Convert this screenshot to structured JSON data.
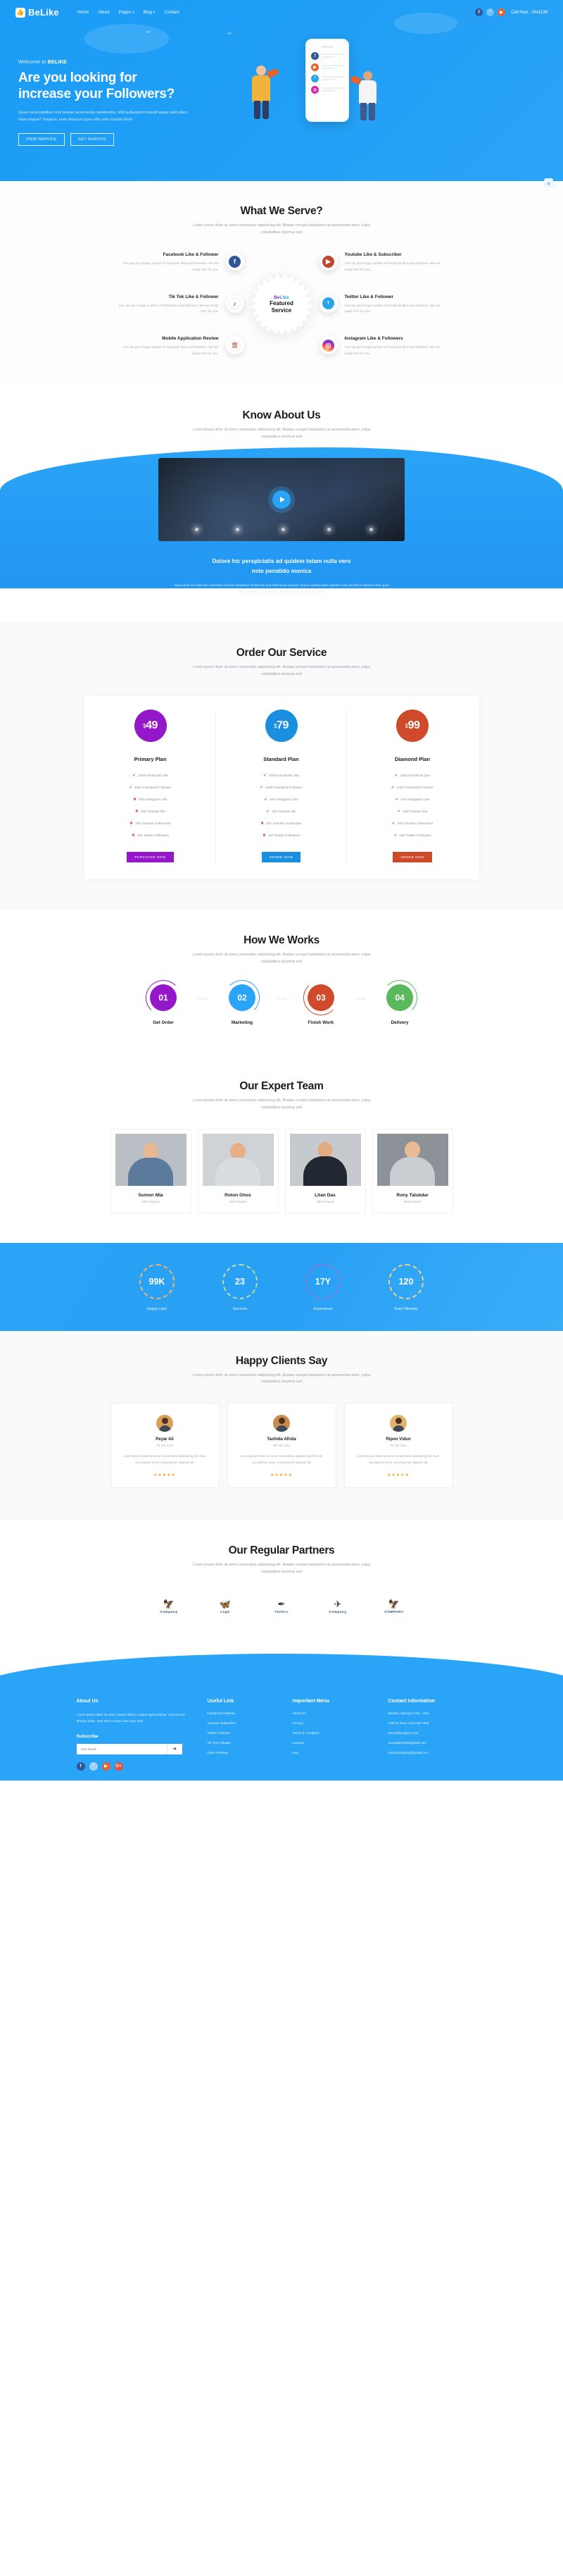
{
  "header": {
    "logo": "BeLike",
    "logo_icon": "thumbs-up-icon",
    "nav": [
      {
        "label": "Home",
        "caret": false
      },
      {
        "label": "About",
        "caret": false
      },
      {
        "label": "Pages",
        "caret": true
      },
      {
        "label": "Blog",
        "caret": true
      },
      {
        "label": "Contact",
        "caret": false
      }
    ],
    "socials": [
      {
        "name": "facebook-icon",
        "glyph": "f"
      },
      {
        "name": "twitter-icon",
        "glyph": "ᵀ"
      },
      {
        "name": "youtube-icon",
        "glyph": "▶"
      }
    ],
    "call_now": "Call Now : 2441139"
  },
  "hero": {
    "welcome_prefix": "Welcome to ",
    "welcome_brand": "BELIKE",
    "title_line1": "Are you looking for",
    "title_line2": "increase your Followers?",
    "paragraph": "Quasi necessitatibus sunt beatae assumenda repellendus, nihil quibusdam impedit eaque velit ullam, totam itaque? Tempore, iusto deserunt quas odio velit corporis illum!",
    "btn_primary": "VIEW SERVICE",
    "btn_secondary": "GET SERVICE"
  },
  "serve": {
    "title": "What We Serve?",
    "subtitle": "Lorem ipsum dolor sit amet consectetur adipisicing elit. Beatae corrupti laudantium at assumenda amet, culpa voluptatibus ducimus sed",
    "hub_brand_a": "Be",
    "hub_brand_b": "Like",
    "hub_line1": "Featured",
    "hub_line2": "Service",
    "left": [
      {
        "title": "Facebook Like & Follower",
        "text": "You can get a huge number of Facebook likes and followers. We are ready 24/7 for you.",
        "icon": "facebook-icon",
        "glyph": "f",
        "cls": "ic-fb"
      },
      {
        "title": "Tik Tok Like & Follower",
        "text": "You can get a huge number of TikTok likes and followers. We are ready 24/7 for you.",
        "icon": "tiktok-icon",
        "glyph": "♪",
        "cls": "ic-tt"
      },
      {
        "title": "Mobile Application Review",
        "text": "You can get a huge number of Facebook likes and followers. We are ready 24/7 for you.",
        "icon": "mobile-icon",
        "glyph": "☰",
        "cls": "ic-mob"
      }
    ],
    "right": [
      {
        "title": "Youtube Like & Subscriber",
        "text": "You can get a huge number of Facebook likes and followers. We are ready 24/7 for you.",
        "icon": "youtube-icon",
        "glyph": "▶",
        "cls": "ic-yt"
      },
      {
        "title": "Twitter Like & Follower",
        "text": "You can get a huge number of Facebook likes and followers. We are ready 24/7 for you.",
        "icon": "twitter-icon",
        "glyph": "ᵀ",
        "cls": "ic-tw"
      },
      {
        "title": "Instagram Like & Followers",
        "text": "You can get a huge number of Facebook likes and followers. We are ready 24/7 for you.",
        "icon": "instagram-icon",
        "glyph": "◎",
        "cls": "ic-ig"
      }
    ]
  },
  "about": {
    "title": "Know About Us",
    "subtitle": "Lorem ipsum dolor sit amet consectetur adipisicing elit. Beatae corrupti laudantium at assumenda amet, culpa voluptatibus ducimus sed",
    "quote_line1": "Dolore hic perspiciatis ad quidem totam nulla vero",
    "quote_line2": "note penatido monica",
    "desc": "Atque dicta illo explicabo molestiae incidunt voluptatem id laborum quis laboriosam placeat. Saepe repellat atque aperiam, eius ad officiis dolorem dicta quod iste voluptas? Nisi quaerat quod ipsum fugit adipisci nesciunt!",
    "play_icon": "play-icon"
  },
  "pricing": {
    "title": "Order Our Service",
    "subtitle": "Lorem ipsum dolor sit amet consectetur adipisicing elit. Beatae corrupti laudantium at assumenda amet, culpa voluptatibus ducimus sed",
    "plans": [
      {
        "currency": "$",
        "price": "49",
        "name": "Primary Plan",
        "button": "PURCHASE NOW",
        "bubble_color": "#9418c9",
        "features": [
          {
            "ok": true,
            "label": "1000 Facebook Like"
          },
          {
            "ok": true,
            "label": "1000 Facebook Follower"
          },
          {
            "ok": false,
            "label": "100 Instagram Like"
          },
          {
            "ok": false,
            "label": "100 Youtube like"
          },
          {
            "ok": false,
            "label": "100 Youtube Subscriber"
          },
          {
            "ok": false,
            "label": "100 Twitter Followers"
          }
        ]
      },
      {
        "currency": "$",
        "price": "79",
        "name": "Standard Plan",
        "button": "ORDER NOW",
        "bubble_color": "#1a8fe0",
        "features": [
          {
            "ok": true,
            "label": "1000 Facebook Like"
          },
          {
            "ok": true,
            "label": "1000 Facebook Follower"
          },
          {
            "ok": true,
            "label": "100 Instagram Like"
          },
          {
            "ok": true,
            "label": "100 Youtube like"
          },
          {
            "ok": false,
            "label": "100 Youtube Subscriber"
          },
          {
            "ok": false,
            "label": "100 Twitter Followers"
          }
        ]
      },
      {
        "currency": "$",
        "price": "99",
        "name": "Diamond Plan",
        "button": "ORDER NOW",
        "bubble_color": "#cf4a2a",
        "features": [
          {
            "ok": true,
            "label": "1000 Facebook Like"
          },
          {
            "ok": true,
            "label": "1000 Facebook Follower"
          },
          {
            "ok": true,
            "label": "100 Instagram Like"
          },
          {
            "ok": true,
            "label": "100 Youtube like"
          },
          {
            "ok": true,
            "label": "100 Youtube Subscriber"
          },
          {
            "ok": true,
            "label": "100 Twitter Followers"
          }
        ]
      }
    ]
  },
  "works": {
    "title": "How We Works",
    "subtitle": "Lorem ipsum dolor sit amet consectetur adipisicing elit. Beatae corrupti laudantium at assumenda amet, culpa voluptatibus ducimus sed",
    "steps": [
      {
        "num": "01",
        "label": "Get Order",
        "color": "#9418c9"
      },
      {
        "num": "02",
        "label": "Marketing",
        "color": "#2aa4f7"
      },
      {
        "num": "03",
        "label": "Finish Work",
        "color": "#cf4a2a"
      },
      {
        "num": "04",
        "label": "Delivery",
        "color": "#5cb85c"
      }
    ]
  },
  "team": {
    "title": "Our Expert Team",
    "subtitle": "Lorem ipsum dolor sit amet consectetur adipisicing elit. Beatae corrupti laudantium at assumenda amet, culpa voluptatibus ducimus sed",
    "members": [
      {
        "name": "Sumon Mia",
        "role": "SEO Expert",
        "skin": "#e8b893",
        "shirt": "#5b7a9c",
        "bg": "#b9bfc4"
      },
      {
        "name": "Roton Ghos",
        "role": "SEO Expert",
        "skin": "#e6b087",
        "shirt": "#d9dde0",
        "bg": "#cfd3d6"
      },
      {
        "name": "Litan Das",
        "role": "SEO Expert",
        "skin": "#e3ab80",
        "shirt": "#222831",
        "bg": "#c6cace"
      },
      {
        "name": "Rony Talukdar",
        "role": "SEO Expert",
        "skin": "#e9bb94",
        "shirt": "#c9ced2",
        "bg": "#8c9298"
      }
    ]
  },
  "counter": [
    {
      "value": "99K",
      "label": "Happy User",
      "ring": "o"
    },
    {
      "value": "23",
      "label": "Services",
      "ring": "g"
    },
    {
      "value": "17Y",
      "label": "Experience",
      "ring": "p"
    },
    {
      "value": "120",
      "label": "Team Member",
      "ring": "y"
    }
  ],
  "testimonial": {
    "title": "Happy Clients Say",
    "subtitle": "Lorem ipsum dolor sit amet consectetur adipisicing elit. Beatae corrupti laudantium at assumenda amet, culpa voluptatibus ducimus sed",
    "items": [
      {
        "name": "Peyar Ali",
        "role": "Tik Tok Actor",
        "text": "Lorem ipsum dolor sit amet consectetur adipisicing elit. Eum accusamus esse consequuntur aliquam ab",
        "stars": "★★★★★",
        "av": ""
      },
      {
        "name": "Taohida Afrida",
        "role": "Tik Tok Actor",
        "text": "Lorem ipsum dolor sit amet consectetur adipisicing elit. Eum accusamus esse consequuntur aliquam ab",
        "stars": "★★★★★",
        "av": "b"
      },
      {
        "name": "Ripon Viduo",
        "role": "Tik Tok Actor",
        "text": "Lorem ipsum dolor sit amet consectetur adipisicing elit. Eum accusamus esse consequuntur aliquam ab",
        "stars": "★★★★★",
        "av": "c"
      }
    ]
  },
  "partners": {
    "title": "Our Regular Partners",
    "subtitle": "Lorem ipsum dolor sit amet consectetur adipisicing elit. Beatae corrupti laudantium at assumenda amet, culpa voluptatibus ducimus sed",
    "logos": [
      {
        "mark": "🦅",
        "name": "Company",
        "color": "#2f6fb5"
      },
      {
        "mark": "🦋",
        "name": "Logo",
        "color": "#e8622c"
      },
      {
        "mark": "✒",
        "name": "Tailors",
        "color": "#3a3a3a"
      },
      {
        "mark": "✈",
        "name": "Company",
        "color": "#2aa4f7"
      },
      {
        "mark": "🦅",
        "name": "COMPANY",
        "color": "#1a5fa8"
      }
    ]
  },
  "footer": {
    "about_title": "About Us",
    "about_text": "Lorem ipsum dolor sit amet, mauris libero congue eget pulvinar, cras ut mus tempus dolor, ante tortor ornare ante arcu nam",
    "subscribe_title": "Subscribe",
    "subscribe_placeholder": "Your Email",
    "subscribe_button_icon": "arrow-right-icon",
    "socials": [
      {
        "name": "facebook-icon",
        "glyph": "f",
        "cls": "fs-fb"
      },
      {
        "name": "twitter-icon",
        "glyph": "ᵀ",
        "cls": "fs-tw"
      },
      {
        "name": "youtube-icon",
        "glyph": "▶",
        "cls": "fs-yt"
      },
      {
        "name": "google-plus-icon",
        "glyph": "G+",
        "cls": "fs-gp"
      }
    ],
    "useful_title": "Useful Link",
    "useful": [
      "Facebook Follower",
      "Youtube Subscriber",
      "Twitter Follower",
      "Tik Tok Follower",
      "Likee Follower"
    ],
    "menu_title": "Important Menu",
    "menu": [
      "About Us",
      "Privacy",
      "Terms & Condition",
      "Contact",
      "Faq"
    ],
    "contact_title": "Contact Information",
    "contact": [
      "Medino, kitaniya road , USA",
      "Call Us Now 1-234-567-890",
      "Demo@support.com",
      "Exmaple4500@gmail.com",
      "Democompany@gmail.com"
    ]
  }
}
